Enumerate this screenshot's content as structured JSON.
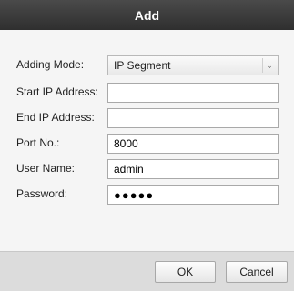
{
  "dialog": {
    "title": "Add",
    "labels": {
      "adding_mode": "Adding Mode:",
      "start_ip": "Start IP Address:",
      "end_ip": "End IP Address:",
      "port": "Port No.:",
      "user_name": "User Name:",
      "password": "Password:"
    },
    "fields": {
      "adding_mode": "IP Segment",
      "start_ip": "",
      "end_ip": "",
      "port": "8000",
      "user_name": "admin",
      "password": "●●●●●"
    },
    "buttons": {
      "ok": "OK",
      "cancel": "Cancel"
    }
  }
}
